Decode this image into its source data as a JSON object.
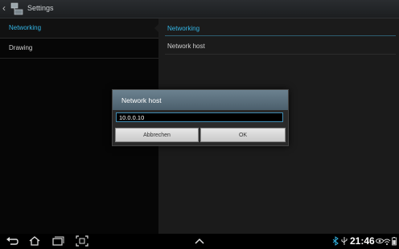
{
  "actionbar": {
    "title": "Settings"
  },
  "left_pane": {
    "items": [
      {
        "label": "Networking",
        "selected": true
      },
      {
        "label": "Drawing",
        "selected": false
      }
    ]
  },
  "right_pane": {
    "category_title": "Networking",
    "pref_title": "Network host"
  },
  "dialog": {
    "title": "Network host",
    "input_value": "10.0.0.10",
    "cancel_label": "Abbrechen",
    "ok_label": "OK"
  },
  "statusbar": {
    "time": "21:46"
  },
  "colors": {
    "accent": "#33b5e5"
  }
}
